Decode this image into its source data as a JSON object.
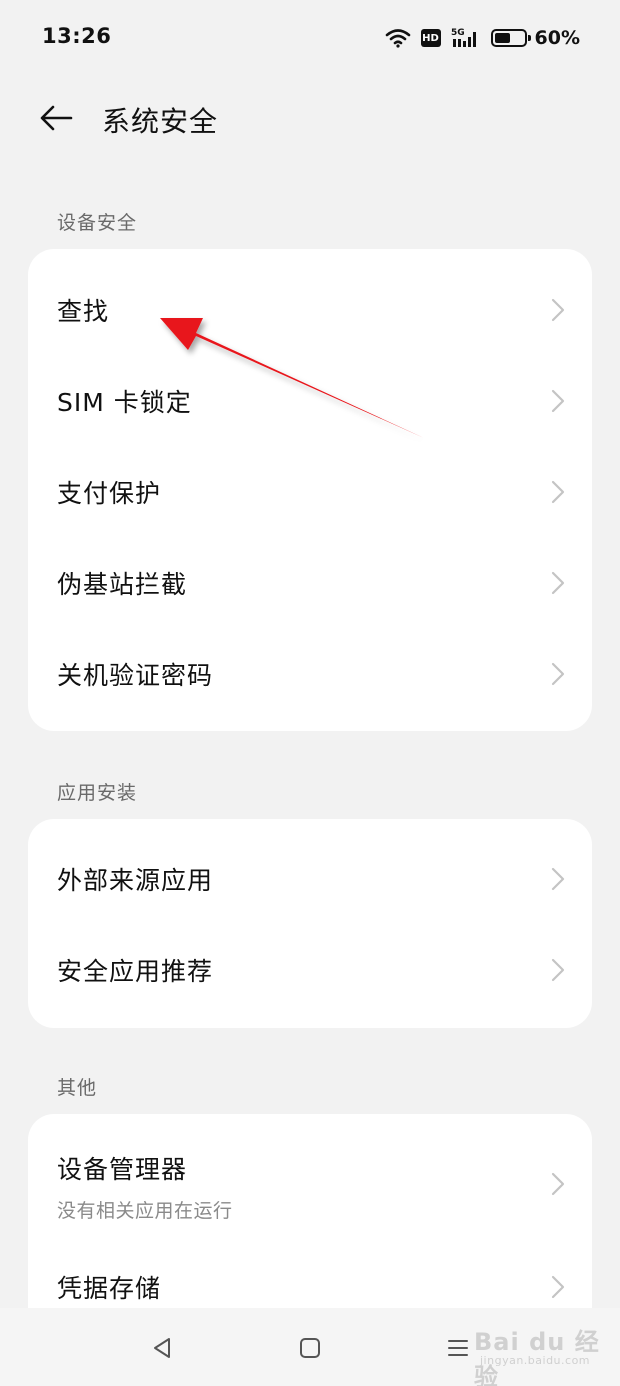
{
  "status_bar": {
    "time": "13:26",
    "hd": "HD",
    "network": "5G",
    "battery_level": 0.6,
    "battery_percent": "60%"
  },
  "header": {
    "back_icon": "arrow-left-icon",
    "title": "系统安全"
  },
  "sections": {
    "device_security": {
      "label": "设备安全",
      "items": [
        {
          "label": "查找"
        },
        {
          "label": "SIM 卡锁定"
        },
        {
          "label": "支付保护"
        },
        {
          "label": "伪基站拦截"
        },
        {
          "label": "关机验证密码"
        }
      ]
    },
    "app_install": {
      "label": "应用安装",
      "items": [
        {
          "label": "外部来源应用"
        },
        {
          "label": "安全应用推荐"
        }
      ]
    },
    "other": {
      "label": "其他",
      "items": [
        {
          "label": "设备管理器",
          "subtitle": "没有相关应用在运行"
        },
        {
          "label": "凭据存储"
        }
      ]
    }
  },
  "navigation": {
    "back": "triangle-back-icon",
    "home": "square-home-icon",
    "menu": "menu-lines-icon"
  },
  "watermark": {
    "text": "Bai du 经验",
    "sub": "jingyan.baidu.com"
  },
  "colors": {
    "background": "#f2f2f2",
    "card": "#ffffff",
    "annotation_arrow": "#e8191c",
    "chevron": "#c4c4c4"
  }
}
